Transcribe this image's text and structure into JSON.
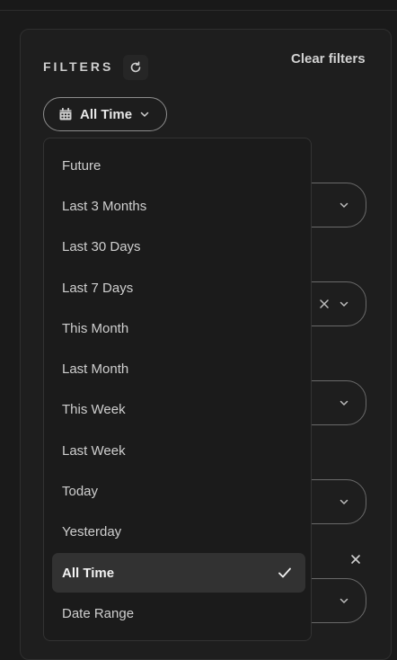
{
  "filters": {
    "title": "FILTERS",
    "clear_label": "Clear filters"
  },
  "date_filter": {
    "selected_label": "All Time"
  },
  "dropdown": {
    "options": [
      {
        "label": "Future"
      },
      {
        "label": "Last 3 Months"
      },
      {
        "label": "Last 30 Days"
      },
      {
        "label": "Last 7 Days"
      },
      {
        "label": "This Month"
      },
      {
        "label": "Last Month"
      },
      {
        "label": "This Week"
      },
      {
        "label": "Last Week"
      },
      {
        "label": "Today"
      },
      {
        "label": "Yesterday"
      },
      {
        "label": "All Time",
        "selected": true
      },
      {
        "label": "Date Range"
      }
    ]
  },
  "icons": {
    "refresh": "refresh-icon",
    "calendar": "calendar-icon",
    "chevron": "chevron-down-icon",
    "check": "check-icon",
    "clear": "close-icon"
  }
}
